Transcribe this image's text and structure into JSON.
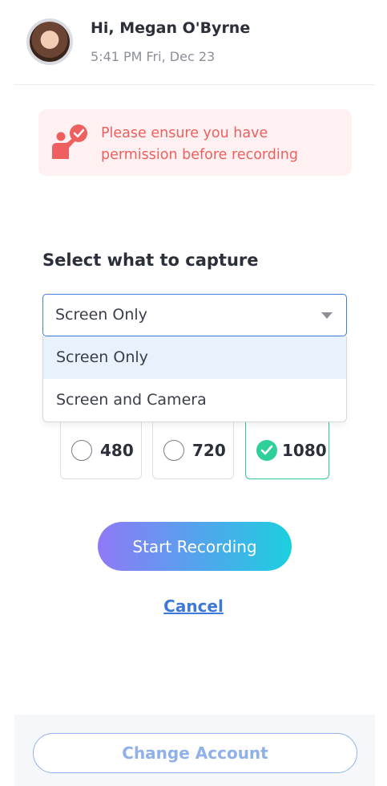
{
  "header": {
    "greeting": "Hi, Megan O'Byrne",
    "datetime": "5:41 PM Fri, Dec 23"
  },
  "notice": {
    "text": "Please ensure you have permission before recording",
    "icon": "person-speech-check-icon",
    "color": "#ee5f5f",
    "background": "#fff1f1"
  },
  "capture": {
    "title": "Select what to capture",
    "selected": "Screen Only",
    "options": [
      "Screen Only",
      "Screen and Camera"
    ]
  },
  "resolution": {
    "options": [
      "480",
      "720",
      "1080"
    ],
    "selected": "1080"
  },
  "actions": {
    "start_label": "Start Recording",
    "cancel_label": "Cancel",
    "change_account_label": "Change Account"
  },
  "colors": {
    "accent_green": "#2fcf9a",
    "link_blue": "#3f79d8",
    "gradient_start": "#8f79f7",
    "gradient_end": "#1cd0de"
  }
}
